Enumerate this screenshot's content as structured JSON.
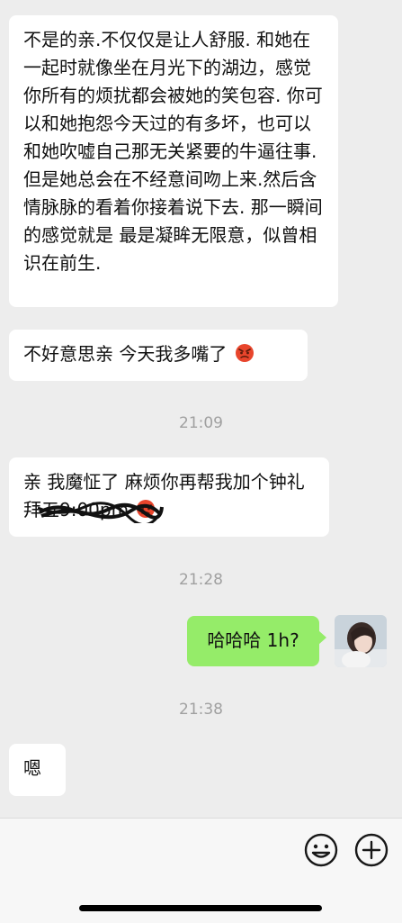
{
  "messages": [
    {
      "text": "不是的亲.不仅仅是让人舒服. 和她在一起时就像坐在月光下的湖边，感觉你所有的烦扰都会被她的笑包容. 你可以和她抱怨今天过的有多坏，也可以和她吹嘘自己那无关紧要的牛逼往事. 但是她总会在不经意间吻上来.然后含情脉脉的看着你接着说下去. 那一瞬间的感觉就是 最是凝眸无限意，似曾相识在前生."
    },
    {
      "text": "不好意思亲 今天我多嘴了",
      "emoji": "angry-face-emoji"
    },
    {
      "time": "21:09"
    },
    {
      "text": "亲 我魔怔了 麻烦你再帮我加个钟礼拜",
      "struck": "五9:00pm",
      "emoji": "angry-face-emoji"
    },
    {
      "time": "21:28"
    },
    {
      "text": "哈哈哈 1h?"
    },
    {
      "time": "21:38"
    },
    {
      "text": "嗯"
    }
  ],
  "input_bar": {
    "icons": [
      "smiley-icon",
      "plus-icon"
    ]
  },
  "colors": {
    "background": "#ededed",
    "incoming_bubble": "#ffffff",
    "outgoing_bubble": "#95ec69",
    "timestamp": "#a0a0a0"
  }
}
